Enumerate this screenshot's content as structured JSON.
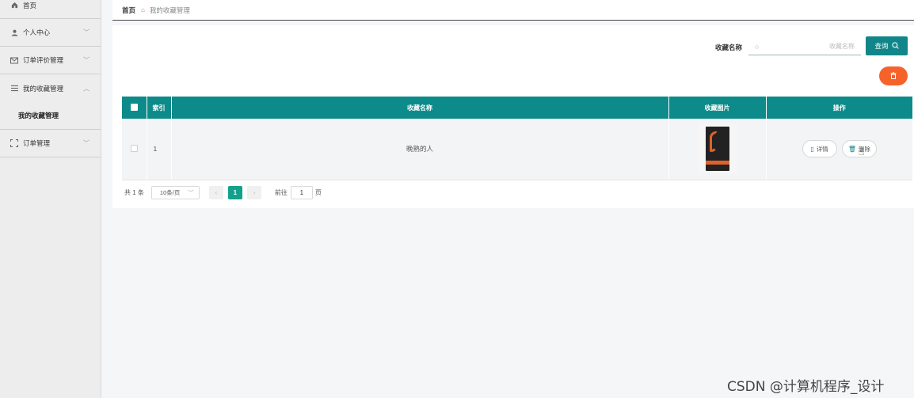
{
  "sidebar": {
    "home_label": "首页",
    "items": [
      {
        "label": "个人中心"
      },
      {
        "label": "订单评价管理"
      },
      {
        "label": "我的收藏管理"
      },
      {
        "label": "订单管理"
      }
    ],
    "submenu_label": "我的收藏管理"
  },
  "breadcrumb": {
    "home": "首页",
    "current": "我的收藏管理"
  },
  "search": {
    "label": "收藏名称",
    "placeholder": "收藏名称",
    "value": "",
    "button_label": "查询"
  },
  "table": {
    "headers": [
      "索引",
      "收藏名称",
      "收藏图片",
      "操作"
    ],
    "rows": [
      {
        "index": "1",
        "name": "晚熟的人",
        "detail_label": "详情",
        "delete_label": "删除"
      }
    ]
  },
  "pagination": {
    "total_text": "共 1 条",
    "page_size": "10条/页",
    "current_page": "1",
    "goto_label": "前往",
    "goto_value": "1",
    "page_suffix": "页"
  },
  "watermark": "CSDN @计算机程序_设计",
  "colors": {
    "primary": "#11868a",
    "danger": "#f5632b",
    "pager_active": "#11a18c"
  }
}
